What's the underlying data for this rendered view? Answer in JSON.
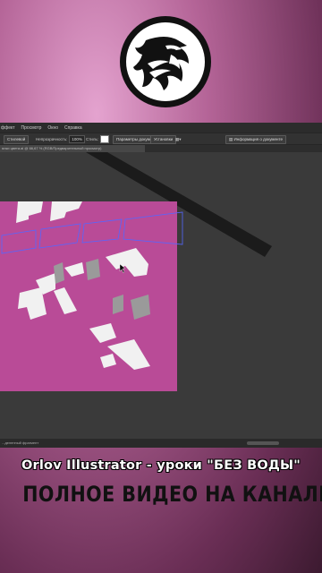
{
  "logo": {
    "icon": "eagle-head-icon"
  },
  "menubar": {
    "items": [
      "ффект",
      "Просмотр",
      "Окно",
      "Справка"
    ]
  },
  "controlbar": {
    "style_button": "Стилевой",
    "opacity_label": "Непрозрачность:",
    "opacity_value": "100%",
    "style_label": "Стиль:",
    "doc_params_button": "Параметры документа",
    "settings_button": "Установки",
    "info_label": "Информация о документе"
  },
  "document_tab": {
    "title": "ялки цвета.ai @ 66,67 % (RGB/Предварительный просмотр)"
  },
  "statusbar": {
    "text": "...деленный фрагмент"
  },
  "colors": {
    "artboard": "#b94b97",
    "app_bg": "#3a3a3a",
    "selection_outline": "#5566ff"
  },
  "captions": {
    "line1": "Orlov Illustrator - уроки \"БЕЗ ВОДЫ\"",
    "line2": "ПОЛНОЕ ВИДЕО НА КАНАЛЕ"
  }
}
